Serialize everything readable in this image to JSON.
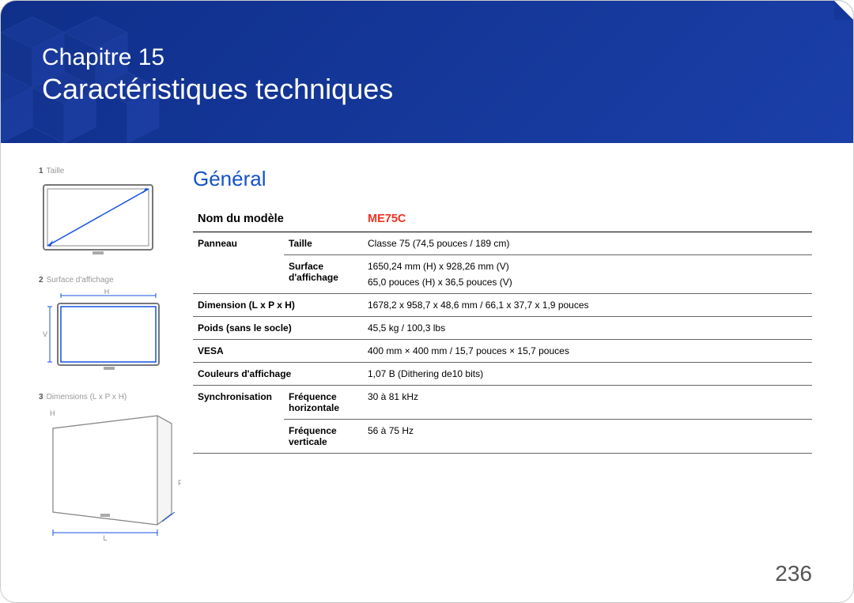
{
  "header": {
    "chapter_label": "Chapitre 15",
    "title": "Caractéristiques techniques"
  },
  "section_title": "Général",
  "illustrations": [
    {
      "num": "1",
      "label": "Taille"
    },
    {
      "num": "2",
      "label": "Surface d'affichage"
    },
    {
      "num": "3",
      "label": "Dimensions (L x P x H)"
    }
  ],
  "fig2": {
    "h": "H",
    "v": "V"
  },
  "fig3": {
    "h": "H",
    "l": "L",
    "p": "P"
  },
  "spec": {
    "model_label": "Nom du modèle",
    "model_value": "ME75C",
    "rows": {
      "panel_label": "Panneau",
      "size_label": "Taille",
      "size_value": "Classe 75 (74,5 pouces / 189 cm)",
      "surf_label": "Surface d'affichage",
      "surf_value1": "1650,24 mm (H) x 928,26 mm (V)",
      "surf_value2": "65,0 pouces (H) x 36,5 pouces (V)",
      "dim_label": "Dimension (L x P x H)",
      "dim_value": "1678,2 x 958,7 x 48,6 mm / 66,1 x 37,7 x 1,9 pouces",
      "weight_label": "Poids (sans le socle)",
      "weight_value": "45,5 kg / 100,3 lbs",
      "vesa_label": "VESA",
      "vesa_value": "400 mm × 400 mm / 15,7 pouces × 15,7 pouces",
      "colors_label": "Couleurs d'affichage",
      "colors_value": "1,07 B (Dithering de10 bits)",
      "sync_label": "Synchronisation",
      "hfreq_label": "Fréquence horizontale",
      "hfreq_value": "30 à 81 kHz",
      "vfreq_label": "Fréquence verticale",
      "vfreq_value": "56 à 75 Hz"
    }
  },
  "page_number": "236"
}
